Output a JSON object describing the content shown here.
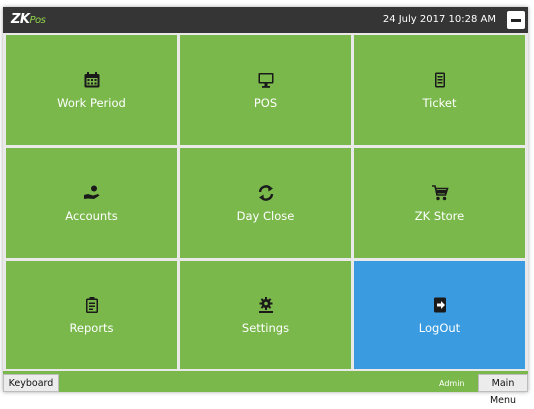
{
  "header": {
    "logo_prefix": "ZK",
    "logo_suffix": "Pos",
    "datetime": "24 July 2017 10:28 AM"
  },
  "tiles": [
    {
      "label": "Work Period",
      "icon": "calendar-icon"
    },
    {
      "label": "POS",
      "icon": "monitor-icon"
    },
    {
      "label": "Ticket",
      "icon": "receipt-icon"
    },
    {
      "label": "Accounts",
      "icon": "hand-coin-icon"
    },
    {
      "label": "Day Close",
      "icon": "refresh-icon"
    },
    {
      "label": "ZK Store",
      "icon": "shopping-cart-icon"
    },
    {
      "label": "Reports",
      "icon": "clipboard-icon"
    },
    {
      "label": "Settings",
      "icon": "gear-icon"
    },
    {
      "label": "LogOut",
      "icon": "sign-out-icon"
    }
  ],
  "footer": {
    "keyboard_label": "Keyboard",
    "user": "Admin",
    "main_menu_label": "Main Menu"
  },
  "colors": {
    "tile_green": "#7ab84b",
    "logout_blue": "#3a9be0",
    "titlebar": "#353535"
  }
}
